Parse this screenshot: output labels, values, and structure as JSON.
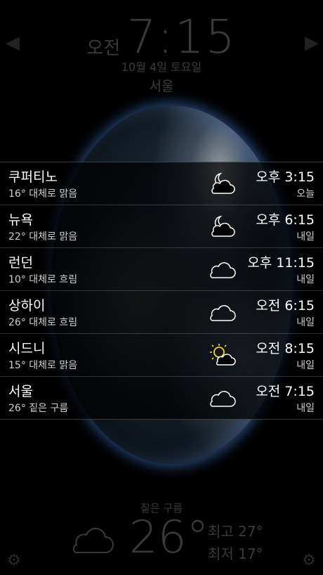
{
  "header": {
    "ampm": "오전",
    "time": "7:15",
    "date": "10월 4일 토요일",
    "city": "서울"
  },
  "cities": [
    {
      "name": "쿠퍼티노",
      "condition": "16°  대체로 맑음",
      "time": "오후 3:15",
      "day": "오늘",
      "icon": "moon-cloud-icon"
    },
    {
      "name": "뉴욕",
      "condition": "22°  대체로 맑음",
      "time": "오후 6:15",
      "day": "내일",
      "icon": "moon-cloud-icon"
    },
    {
      "name": "런던",
      "condition": "10°  대체로 흐림",
      "time": "오후 11:15",
      "day": "내일",
      "icon": "cloud-icon"
    },
    {
      "name": "상하이",
      "condition": "26°  대체로 흐림",
      "time": "오전 6:15",
      "day": "내일",
      "icon": "cloud-icon"
    },
    {
      "name": "시드니",
      "condition": "15°  대체로 맑음",
      "time": "오전 8:15",
      "day": "내일",
      "icon": "sun-cloud-icon"
    },
    {
      "name": "서울",
      "condition": "26°  짙은 구름",
      "time": "오전 7:15",
      "day": "내일",
      "icon": "cloud-icon"
    }
  ],
  "current": {
    "condition": "짙은 구름",
    "temperature": "26°",
    "high": "최고 27°",
    "low": "최저 17°"
  }
}
